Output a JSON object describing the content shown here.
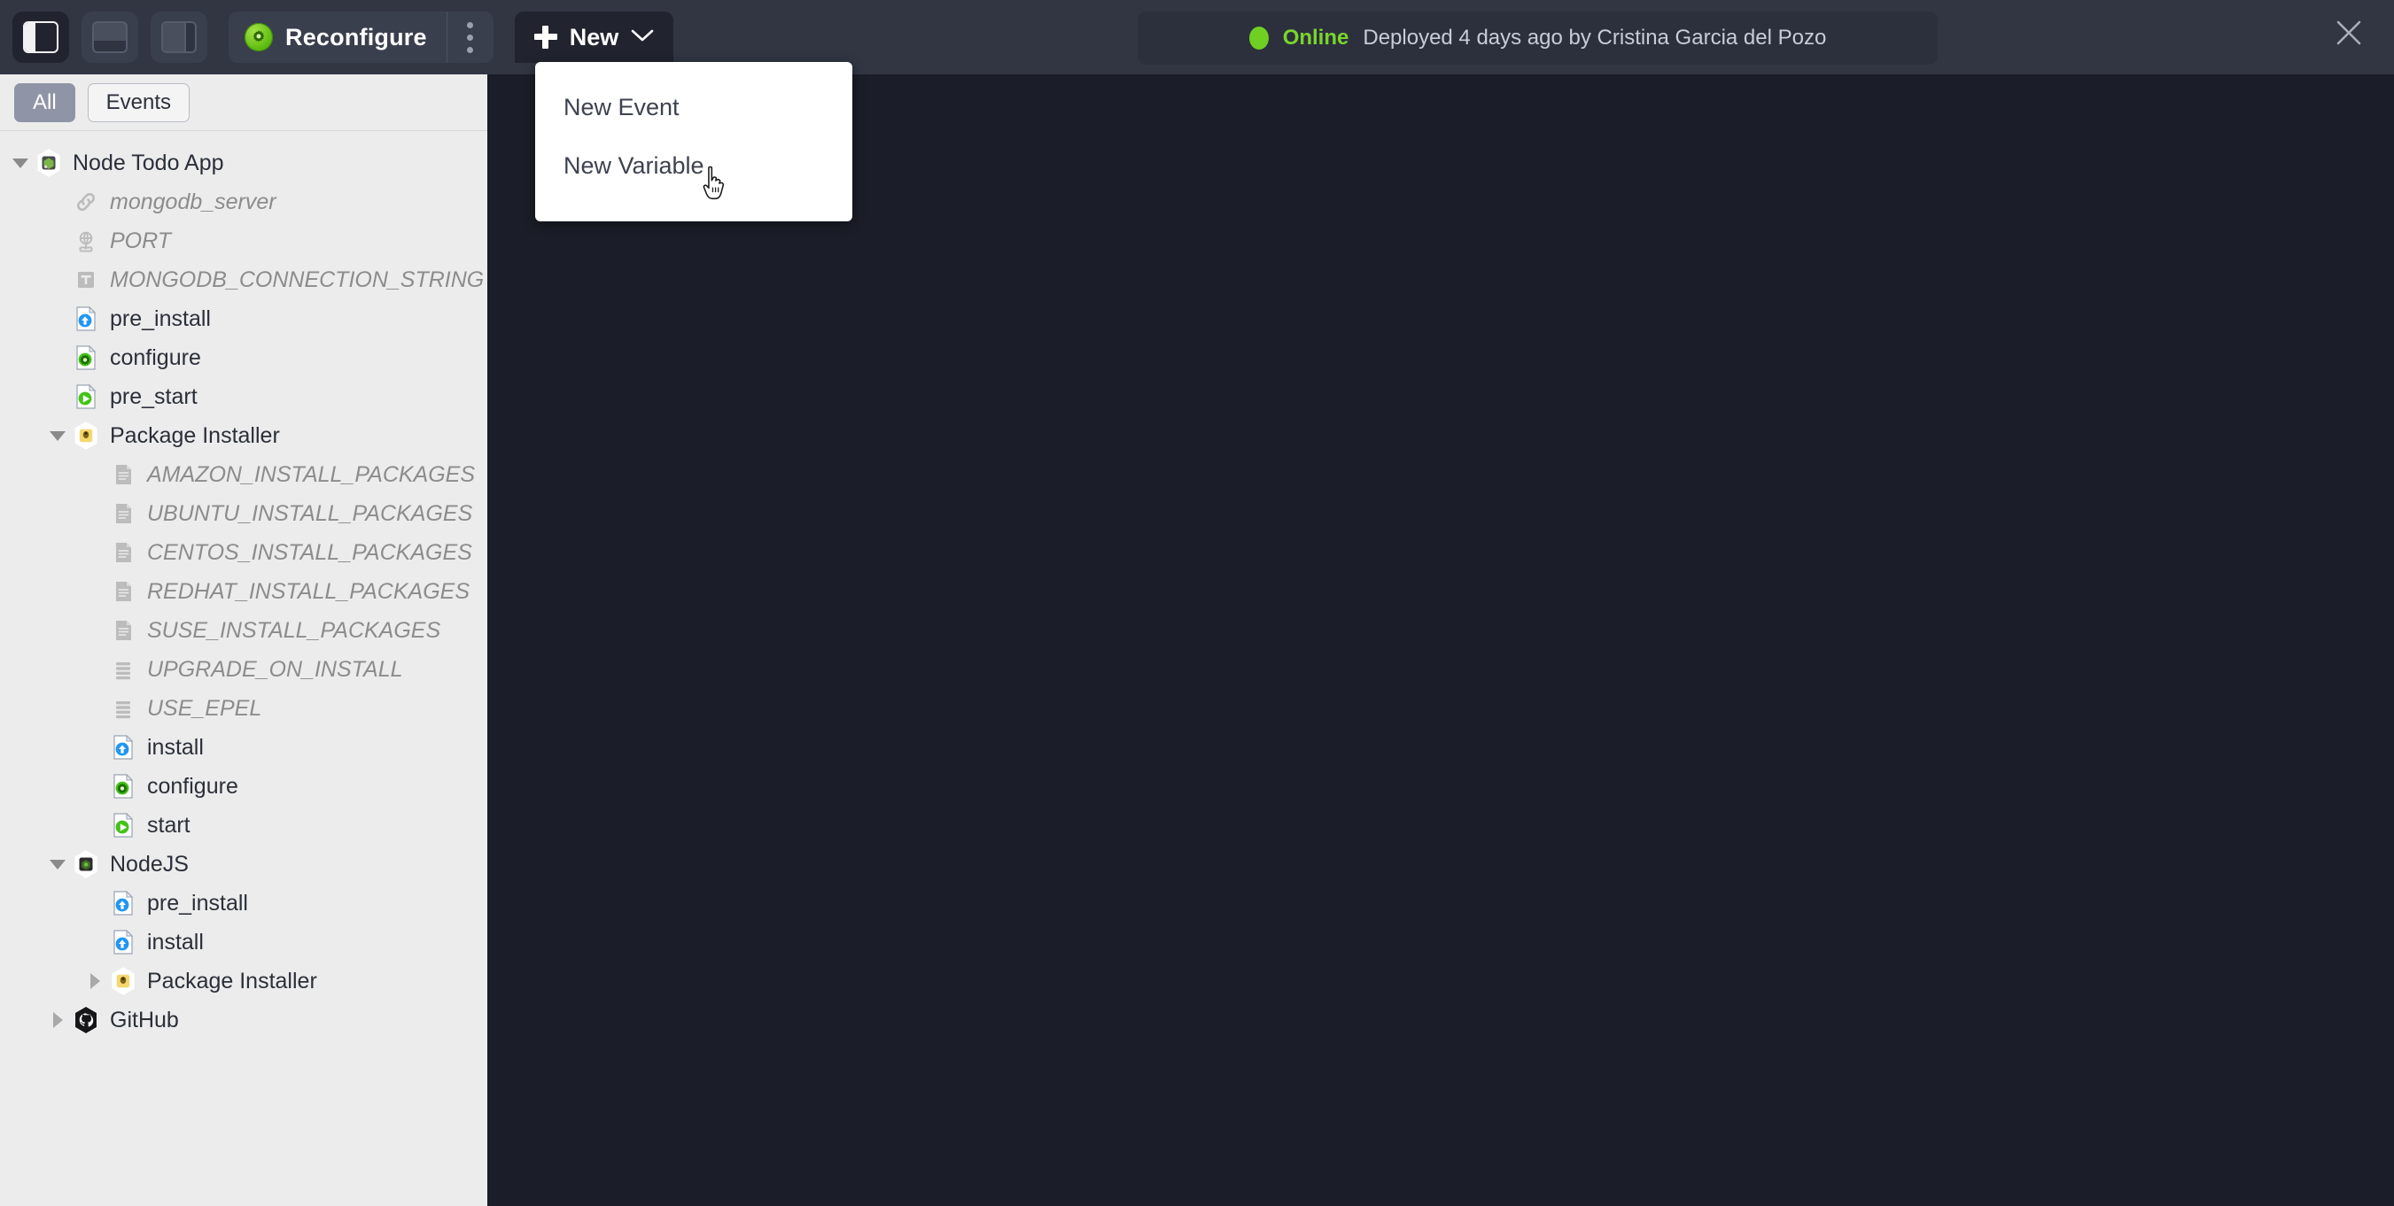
{
  "toolbar": {
    "panel_buttons": [
      {
        "name": "toggle-left-panel",
        "icon": "panel-left-icon",
        "active": true
      },
      {
        "name": "toggle-bottom-panel",
        "icon": "panel-bottom-icon",
        "active": false
      },
      {
        "name": "toggle-right-panel",
        "icon": "panel-right-icon",
        "active": false
      }
    ],
    "reconfigure_label": "Reconfigure",
    "reconfigure_icon": "green-gear-icon",
    "kebab_icon": "more-vertical-icon",
    "new_label": "New",
    "new_plus_icon": "plus-icon",
    "new_chevron_icon": "chevron-down-icon",
    "close_icon": "close-icon"
  },
  "status": {
    "dot_icon": "status-dot-online",
    "state": "Online",
    "deployment": "Deployed 4 days ago by Cristina Garcia del Pozo",
    "online_color": "#79d62b"
  },
  "dropdown": {
    "items": [
      {
        "label": "New Event",
        "name": "menu-item-new-event"
      },
      {
        "label": "New Variable",
        "name": "menu-item-new-variable"
      }
    ]
  },
  "sidebar": {
    "tabs": [
      {
        "label": "All",
        "active": true
      },
      {
        "label": "Events",
        "active": false
      }
    ],
    "tree": [
      {
        "label": "Node Todo App",
        "indent": 0,
        "twisty": "down",
        "icon": "nodejs-app-hex-icon",
        "kind": "component"
      },
      {
        "label": "mongodb_server",
        "indent": 1,
        "twisty": "none",
        "icon": "link-icon",
        "kind": "variable"
      },
      {
        "label": "PORT",
        "indent": 1,
        "twisty": "none",
        "icon": "network-globe-icon",
        "kind": "variable"
      },
      {
        "label": "MONGODB_CONNECTION_STRING",
        "indent": 1,
        "twisty": "none",
        "icon": "text-variable-icon",
        "kind": "variable"
      },
      {
        "label": "pre_install",
        "indent": 1,
        "twisty": "none",
        "icon": "event-install-icon",
        "kind": "event"
      },
      {
        "label": "configure",
        "indent": 1,
        "twisty": "none",
        "icon": "event-configure-icon",
        "kind": "event"
      },
      {
        "label": "pre_start",
        "indent": 1,
        "twisty": "none",
        "icon": "event-start-icon",
        "kind": "event"
      },
      {
        "label": "Package Installer",
        "indent": 1,
        "twisty": "down",
        "icon": "package-installer-hex-icon",
        "kind": "component"
      },
      {
        "label": "AMAZON_INSTALL_PACKAGES",
        "indent": 2,
        "twisty": "none",
        "icon": "document-icon",
        "kind": "variable"
      },
      {
        "label": "UBUNTU_INSTALL_PACKAGES",
        "indent": 2,
        "twisty": "none",
        "icon": "document-icon",
        "kind": "variable"
      },
      {
        "label": "CENTOS_INSTALL_PACKAGES",
        "indent": 2,
        "twisty": "none",
        "icon": "document-icon",
        "kind": "variable"
      },
      {
        "label": "REDHAT_INSTALL_PACKAGES",
        "indent": 2,
        "twisty": "none",
        "icon": "document-icon",
        "kind": "variable"
      },
      {
        "label": "SUSE_INSTALL_PACKAGES",
        "indent": 2,
        "twisty": "none",
        "icon": "document-icon",
        "kind": "variable"
      },
      {
        "label": "UPGRADE_ON_INSTALL",
        "indent": 2,
        "twisty": "none",
        "icon": "list-lines-icon",
        "kind": "variable"
      },
      {
        "label": "USE_EPEL",
        "indent": 2,
        "twisty": "none",
        "icon": "list-lines-icon",
        "kind": "variable"
      },
      {
        "label": "install",
        "indent": 2,
        "twisty": "none",
        "icon": "event-install-icon",
        "kind": "event"
      },
      {
        "label": "configure",
        "indent": 2,
        "twisty": "none",
        "icon": "event-configure-icon",
        "kind": "event"
      },
      {
        "label": "start",
        "indent": 2,
        "twisty": "none",
        "icon": "event-start-icon",
        "kind": "event"
      },
      {
        "label": "NodeJS",
        "indent": 1,
        "twisty": "down",
        "icon": "nodejs-hex-icon",
        "kind": "component"
      },
      {
        "label": "pre_install",
        "indent": 2,
        "twisty": "none",
        "icon": "event-install-icon",
        "kind": "event"
      },
      {
        "label": "install",
        "indent": 2,
        "twisty": "none",
        "icon": "event-install-icon",
        "kind": "event"
      },
      {
        "label": "Package Installer",
        "indent": 2,
        "twisty": "right",
        "icon": "package-installer-hex-icon",
        "kind": "component"
      },
      {
        "label": "GitHub",
        "indent": 1,
        "twisty": "right",
        "icon": "github-hex-icon",
        "kind": "component"
      }
    ]
  },
  "colors": {
    "toolbar_bg": "#323643",
    "canvas_bg": "#1b1e28",
    "sidebar_bg": "#ececec",
    "accent_green": "#79d62b",
    "tab_active_bg": "#8f95a6"
  }
}
